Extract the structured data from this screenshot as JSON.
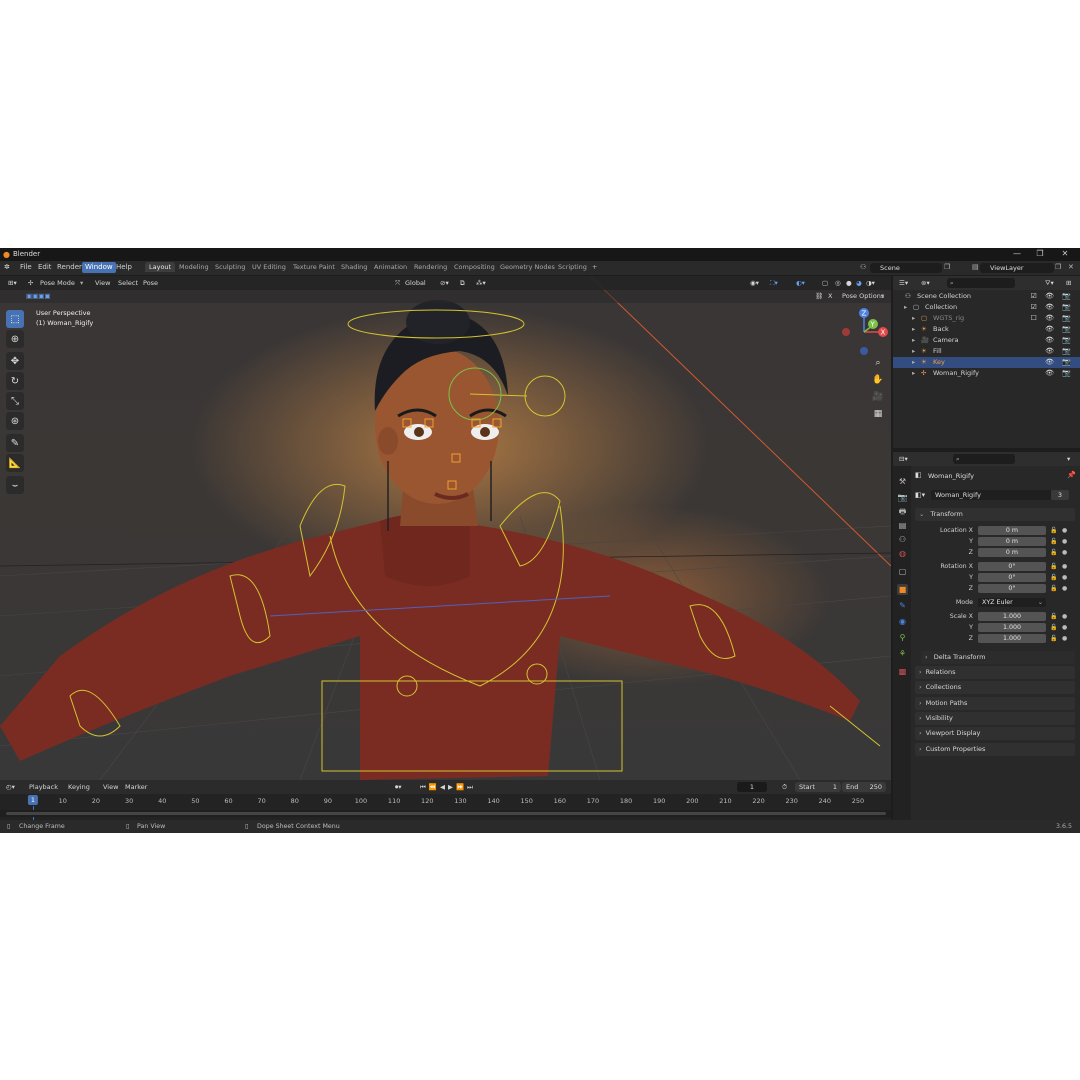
{
  "window": {
    "title": "Blender",
    "controls": [
      "—",
      "❐",
      "✕"
    ]
  },
  "menubar": {
    "menus": [
      "File",
      "Edit",
      "Render",
      "Window",
      "Help"
    ],
    "active_menu": "Window",
    "workspaces": [
      "Layout",
      "Modeling",
      "Sculpting",
      "UV Editing",
      "Texture Paint",
      "Shading",
      "Animation",
      "Rendering",
      "Compositing",
      "Geometry Nodes",
      "Scripting"
    ],
    "active_workspace": "Layout",
    "add_tab": "+",
    "scene": "Scene",
    "view_layer": "ViewLayer"
  },
  "viewport": {
    "mode": "Pose Mode",
    "menus": [
      "View",
      "Select",
      "Pose"
    ],
    "orientation": "Global",
    "pose_options": "Pose Options",
    "overlay_info": [
      "User Perspective",
      "(1) Woman_Rigify"
    ],
    "gizmo_axes": [
      "Z",
      "Y",
      "X"
    ],
    "colors": {
      "x_axis": "#e04a4a",
      "y_axis": "#7cc24a",
      "z_axis": "#4f82e0",
      "bones": "#d4c430",
      "select": "#f29f2f"
    }
  },
  "outliner": {
    "rows": [
      {
        "label": "Scene Collection",
        "indent": 0,
        "selected": false,
        "dim": false
      },
      {
        "label": "Collection",
        "indent": 1,
        "selected": false,
        "dim": false
      },
      {
        "label": "WGTS_rig",
        "indent": 2,
        "selected": false,
        "dim": true
      },
      {
        "label": "Back",
        "indent": 2,
        "selected": false,
        "dim": false
      },
      {
        "label": "Camera",
        "indent": 2,
        "selected": false,
        "dim": false
      },
      {
        "label": "Fill",
        "indent": 2,
        "selected": false,
        "dim": false
      },
      {
        "label": "Key",
        "indent": 2,
        "selected": true,
        "dim": false
      },
      {
        "label": "Woman_Rigify",
        "indent": 2,
        "selected": false,
        "dim": false
      }
    ]
  },
  "properties": {
    "object_name": "Woman_Rigify",
    "data_name": "Woman_Rigify",
    "users": "3",
    "transform": {
      "title": "Transform",
      "location_label": "Location X",
      "location": [
        "0 m",
        "0 m",
        "0 m"
      ],
      "rotation_label": "Rotation X",
      "rotation": [
        "0°",
        "0°",
        "0°"
      ],
      "mode_label": "Mode",
      "mode": "XYZ Euler",
      "scale_label": "Scale X",
      "scale": [
        "1.000",
        "1.000",
        "1.000"
      ],
      "y_label": "Y",
      "z_label": "Z"
    },
    "subpanels": [
      "Delta Transform"
    ],
    "panels": [
      "Relations",
      "Collections",
      "Motion Paths",
      "Visibility",
      "Viewport Display",
      "Custom Properties"
    ]
  },
  "timeline": {
    "menus": [
      "Playback",
      "Keying",
      "View",
      "Marker"
    ],
    "current_frame": "1",
    "start_label": "Start",
    "start": "1",
    "end_label": "End",
    "end": "250",
    "ticks": [
      "1",
      "10",
      "20",
      "30",
      "40",
      "50",
      "60",
      "70",
      "80",
      "90",
      "100",
      "110",
      "120",
      "130",
      "140",
      "150",
      "160",
      "170",
      "180",
      "190",
      "200",
      "210",
      "220",
      "230",
      "240",
      "250"
    ]
  },
  "statusbar": {
    "items": [
      "Change Frame",
      "Pan View",
      "Dope Sheet Context Menu"
    ],
    "version": "3.6.5"
  }
}
